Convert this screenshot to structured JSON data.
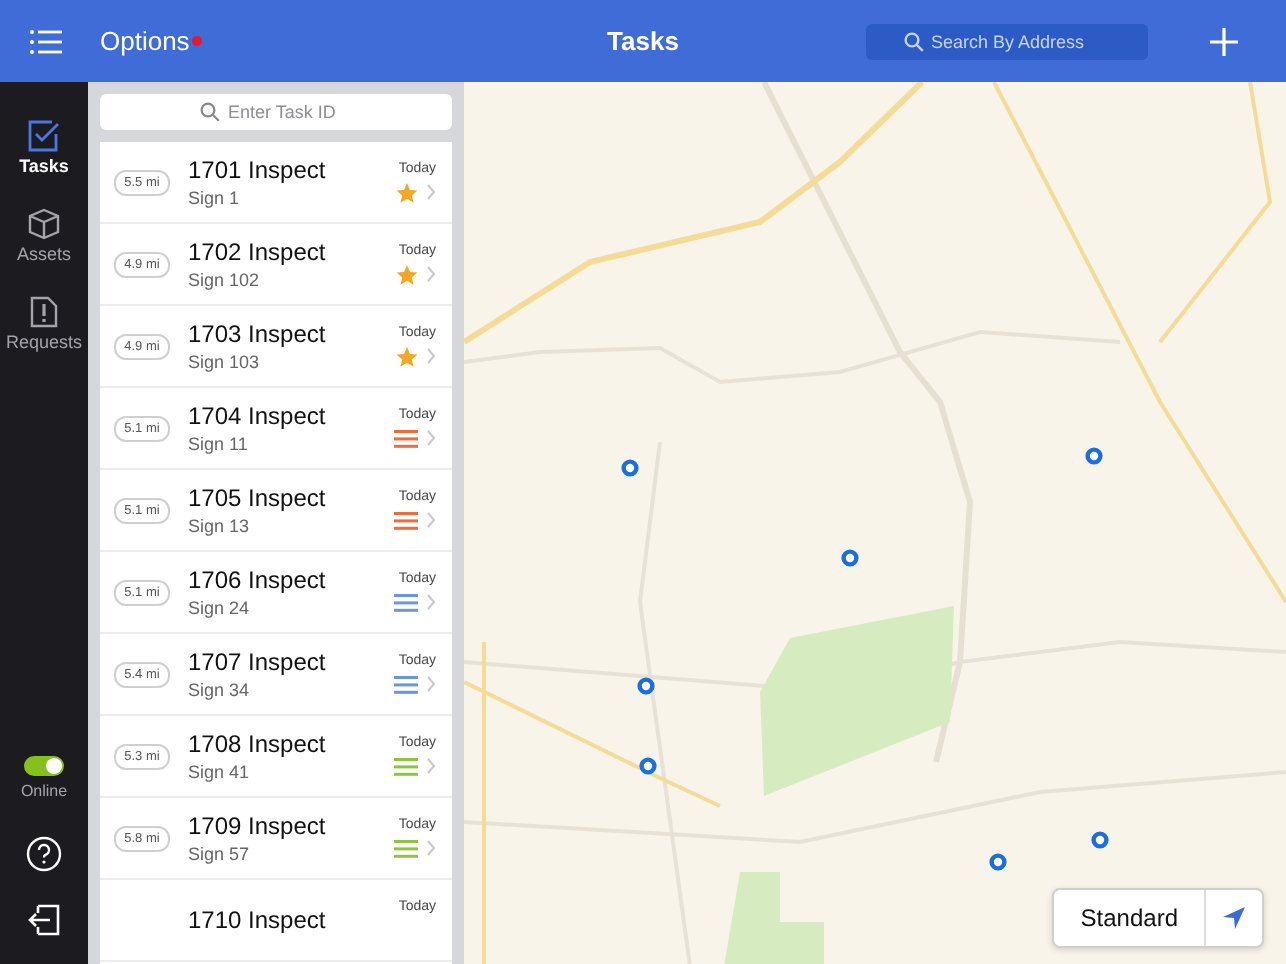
{
  "top_bar": {
    "options": "Options",
    "options_alert": true,
    "title": "Tasks",
    "search": {
      "placeholder": "Search By Address"
    }
  },
  "sidebar": {
    "items": [
      {
        "label": "Tasks",
        "kind": "tasks",
        "selected": true
      },
      {
        "label": "Assets",
        "kind": "assets",
        "selected": false
      },
      {
        "label": "Requests",
        "kind": "requests",
        "selected": false
      }
    ],
    "online": {
      "label": "Online",
      "on": true
    }
  },
  "task_search": {
    "placeholder": "Enter Task ID"
  },
  "tasks": [
    {
      "distance": "5.5 mi",
      "title": "1701 Inspect",
      "subtitle": "Sign 1",
      "due": "Today",
      "kind": "star",
      "color": "#f5a623"
    },
    {
      "distance": "4.9 mi",
      "title": "1702 Inspect",
      "subtitle": "Sign 102",
      "due": "Today",
      "kind": "star",
      "color": "#f5a623"
    },
    {
      "distance": "4.9 mi",
      "title": "1703 Inspect",
      "subtitle": "Sign 103",
      "due": "Today",
      "kind": "star",
      "color": "#f5a623"
    },
    {
      "distance": "5.1 mi",
      "title": "1704 Inspect",
      "subtitle": "Sign 11",
      "due": "Today",
      "kind": "lines",
      "color": "#f06a3a"
    },
    {
      "distance": "5.1 mi",
      "title": "1705 Inspect",
      "subtitle": "Sign 13",
      "due": "Today",
      "kind": "lines",
      "color": "#f06a3a"
    },
    {
      "distance": "5.1 mi",
      "title": "1706 Inspect",
      "subtitle": "Sign 24",
      "due": "Today",
      "kind": "lines",
      "color": "#6b95e0"
    },
    {
      "distance": "5.4 mi",
      "title": "1707 Inspect",
      "subtitle": "Sign 34",
      "due": "Today",
      "kind": "lines",
      "color": "#6b95e0"
    },
    {
      "distance": "5.3 mi",
      "title": "1708 Inspect",
      "subtitle": "Sign 41",
      "due": "Today",
      "kind": "lines",
      "color": "#8cc63f"
    },
    {
      "distance": "5.8 mi",
      "title": "1709 Inspect",
      "subtitle": "Sign 57",
      "due": "Today",
      "kind": "lines",
      "color": "#8cc63f"
    },
    {
      "title": "1710 Inspect",
      "due": "Today",
      "kind": "none"
    }
  ],
  "map": {
    "mode_button": "Standard"
  }
}
